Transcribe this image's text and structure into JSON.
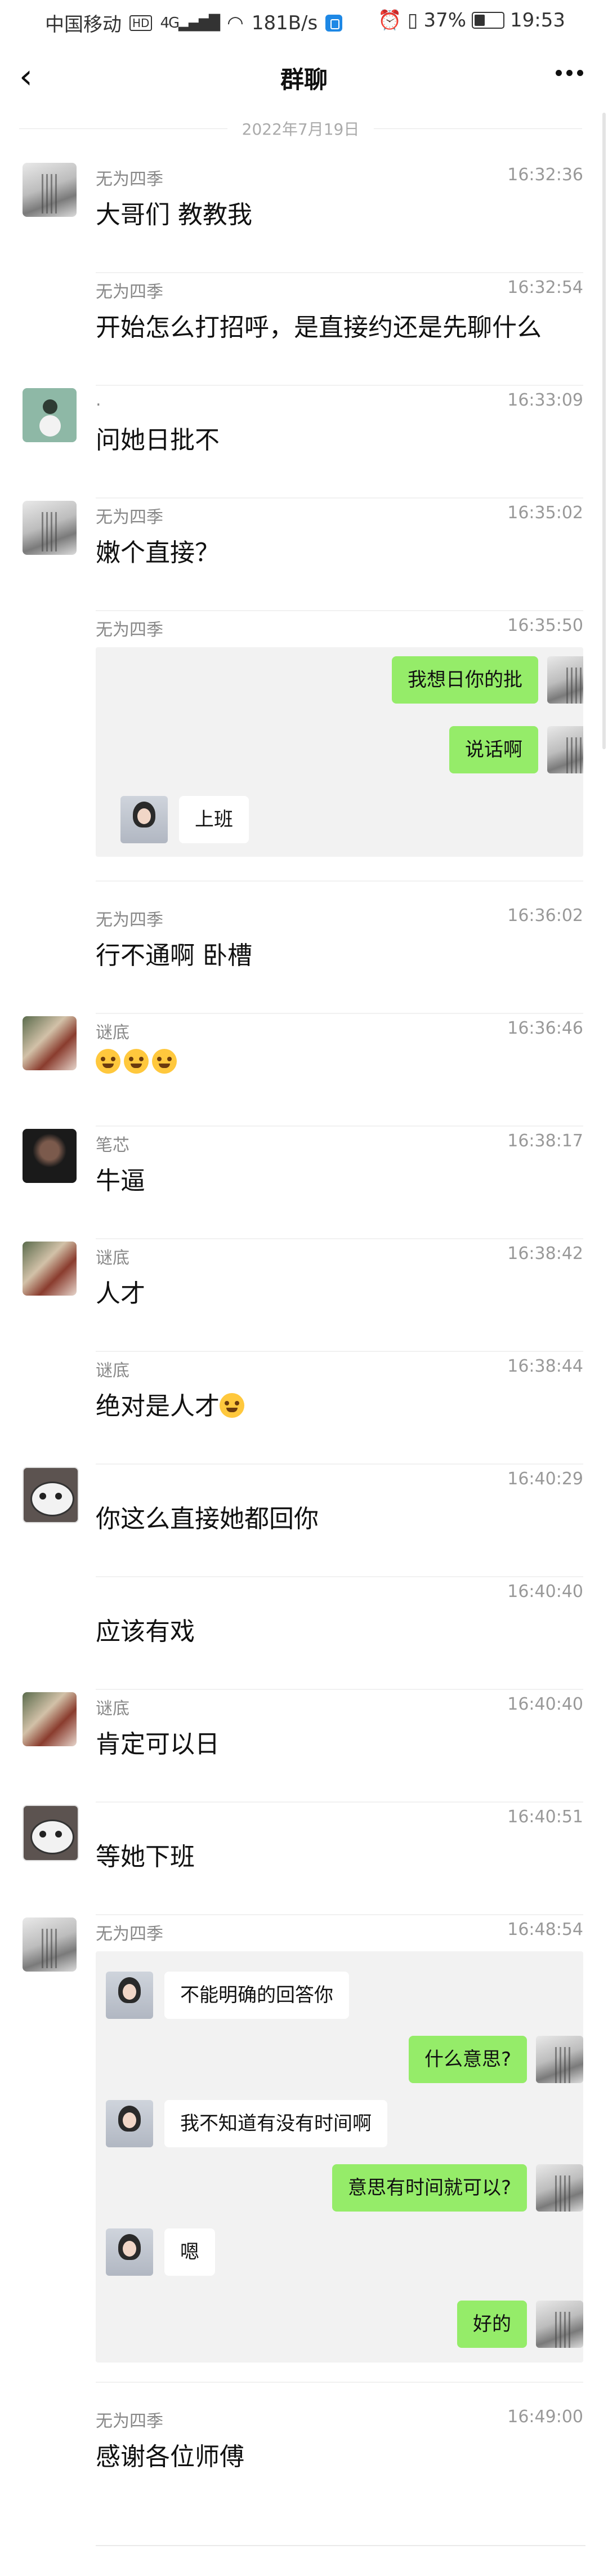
{
  "status_bar": {
    "carrier": "中国移动",
    "hd": "HD",
    "network": "4G",
    "speed": "181B/s",
    "battery_level": 0.37,
    "battery": "37%",
    "time": "19:53"
  },
  "header": {
    "title": "群聊"
  },
  "date": "2022年7月19日",
  "messages": [
    {
      "sender": "无为四季",
      "time": "16:32:36",
      "text": "大哥们 教教我",
      "avatar": "tree"
    },
    {
      "sender": "无为四季",
      "time": "16:32:54",
      "text": "开始怎么打招呼，是直接约还是先聊什么"
    },
    {
      "sender": ".",
      "time": "16:33:09",
      "text": "问她日批不",
      "avatar": "green"
    },
    {
      "sender": "无为四季",
      "time": "16:35:02",
      "text": "嫩个直接？",
      "avatar": "tree"
    },
    {
      "sender": "无为四季",
      "time": "16:35:50",
      "screenshot": [
        {
          "side": "right",
          "text": "我想日你的批"
        },
        {
          "side": "right",
          "text": "说话啊"
        },
        {
          "side": "left",
          "text": "上班"
        }
      ]
    },
    {
      "sender": "无为四季",
      "time": "16:36:02",
      "text": "行不通啊 卧槽"
    },
    {
      "sender": "谜底",
      "time": "16:36:46",
      "emoji_count": 3,
      "avatar": "crowd"
    },
    {
      "sender": "笔芯",
      "time": "16:38:17",
      "text": "牛逼",
      "avatar": "dark"
    },
    {
      "sender": "谜底",
      "time": "16:38:42",
      "text": "人才",
      "avatar": "crowd"
    },
    {
      "sender": "谜底",
      "time": "16:38:44",
      "text": "绝对是人才"
    },
    {
      "sender": "",
      "time": "16:40:29",
      "text": "你这么直接她都回你",
      "avatar": "panda-dark"
    },
    {
      "sender": "",
      "time": "16:40:40",
      "text": "应该有戏"
    },
    {
      "sender": "谜底",
      "time": "16:40:40",
      "text": "肯定可以日",
      "avatar": "crowd"
    },
    {
      "sender": "",
      "time": "16:40:51",
      "text": "等她下班",
      "avatar": "panda-dark"
    },
    {
      "sender": "无为四季",
      "time": "16:48:54",
      "avatar": "tree",
      "screenshot": [
        {
          "side": "left",
          "text": "不能明确的回答你"
        },
        {
          "side": "right",
          "text": "什么意思?"
        },
        {
          "side": "left",
          "text": "我不知道有没有时间啊"
        },
        {
          "side": "right",
          "text": "意思有时间就可以?"
        },
        {
          "side": "left",
          "text": "嗯"
        },
        {
          "side": "right",
          "text": "好的"
        }
      ]
    },
    {
      "sender": "无为四季",
      "time": "16:49:00",
      "text": "感谢各位师傅"
    }
  ]
}
